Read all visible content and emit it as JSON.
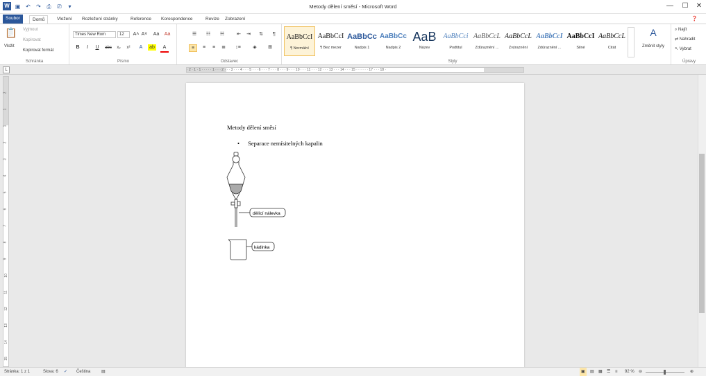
{
  "window": {
    "title": "Metody dělení směsí - Microsoft Word",
    "minimize": "—",
    "maximize": "☐",
    "close": "✕"
  },
  "qat": {
    "app_icon": "W",
    "save_icon": "save-icon",
    "undo_icon": "undo-icon",
    "redo_icon": "redo-icon",
    "print_preview_icon": "print-preview-icon",
    "print_icon": "print-icon",
    "customize": "▾"
  },
  "tabs": [
    "Soubor",
    "Domů",
    "Vložení",
    "Rozložení stránky",
    "Reference",
    "Korespondence",
    "Revize",
    "Zobrazení"
  ],
  "ribbon": {
    "clipboard": {
      "label": "Schránka",
      "paste": "Vložit",
      "cut": "Vyjmout",
      "copy": "Kopírovat",
      "format_painter": "Kopírovat formát"
    },
    "font": {
      "label": "Písmo",
      "font_name": "Times New Rom",
      "font_size": "12",
      "bold": "B",
      "italic": "I",
      "underline": "U",
      "strike": "abc",
      "subscript": "x₂",
      "superscript": "x²",
      "grow": "A˄",
      "shrink": "A˅",
      "case": "Aa",
      "clear": "Aa"
    },
    "paragraph": {
      "label": "Odstavec",
      "pilcrow": "¶"
    },
    "styles": {
      "label": "Styly",
      "change_styles": "Změnit styly",
      "items": [
        {
          "sample": "AaBbCcI",
          "name": "¶ Normální"
        },
        {
          "sample": "AaBbCcI",
          "name": "¶ Bez mezer"
        },
        {
          "sample": "AaBbCc",
          "name": "Nadpis 1"
        },
        {
          "sample": "AaBbCc",
          "name": "Nadpis 2"
        },
        {
          "sample": "AaB",
          "name": "Název"
        },
        {
          "sample": "AaBbCci",
          "name": "Podtitul"
        },
        {
          "sample": "AaBbCcL",
          "name": "Zdůraznění ..."
        },
        {
          "sample": "AaBbCcL",
          "name": "Zvýraznění"
        },
        {
          "sample": "AaBbCcI",
          "name": "Zdůraznění ..."
        },
        {
          "sample": "AaBbCcI",
          "name": "Silné"
        },
        {
          "sample": "AaBbCcL",
          "name": "Citát"
        }
      ]
    },
    "editing": {
      "label": "Úpravy",
      "find": "Najít",
      "replace": "Nahradit",
      "select": "Vybrat"
    }
  },
  "ruler": {
    "tab_selector": "L",
    "marks": "· 2 · 1 · 1 · · · · · 1 · · · 2 · · · 3 · · · 4 · · · 5 · · · 6 · · · 7 · · · 8 · · · 9 · · · 10 · · · 11 · · · 12 · · · 13 · · · 14 · · · 15 · · · · · · 17 · · · 18 ·"
  },
  "vruler_marks": [
    "2",
    "1",
    "1",
    "2",
    "3",
    "4",
    "5",
    "6",
    "7",
    "8",
    "9",
    "10",
    "11",
    "12",
    "13",
    "14",
    "15"
  ],
  "document": {
    "title": "Metody dělení směsí",
    "bullet": "•",
    "bullet_text": "Separace nemísitelných kapalin",
    "callouts": [
      "dělící nálevka",
      "kádinka"
    ]
  },
  "status": {
    "page": "Stránka: 1 z 1",
    "words": "Slova: 6",
    "language": "Čeština",
    "zoom": "92 %"
  }
}
